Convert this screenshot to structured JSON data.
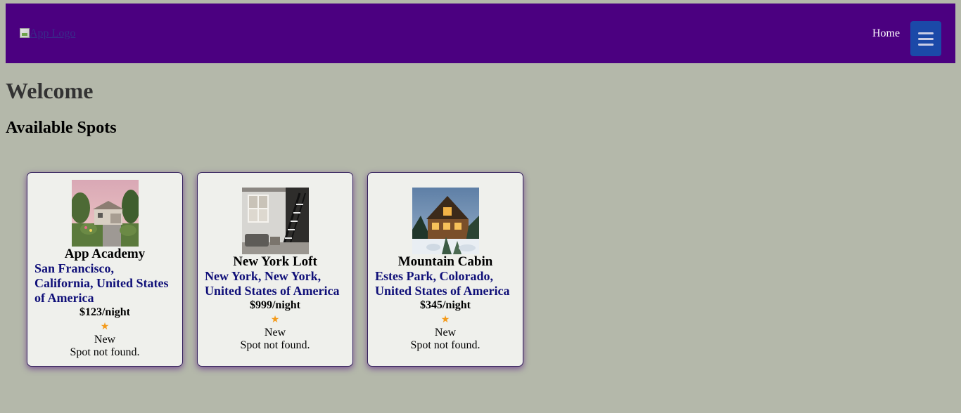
{
  "navbar": {
    "logo_alt": "App Logo",
    "home_label": "Home",
    "menu_icon": "hamburger-menu-icon",
    "background": "#4b0080",
    "menu_button_color": "#1b49a8"
  },
  "main": {
    "heading": "Welcome",
    "subheading": "Available Spots"
  },
  "spots": [
    {
      "name": "App Academy",
      "location": "San Francisco, California, United States of America",
      "price": "$123/night",
      "star": "★",
      "rating": "New",
      "status": "Spot not found."
    },
    {
      "name": "New York Loft",
      "location": "New York, New York, United States of America",
      "price": "$999/night",
      "star": "★",
      "rating": "New",
      "status": "Spot not found."
    },
    {
      "name": "Mountain Cabin",
      "location": "Estes Park, Colorado, United States of America",
      "price": "$345/night",
      "star": "★",
      "rating": "New",
      "status": "Spot not found."
    }
  ],
  "colors": {
    "page_background": "#b4b8aa",
    "card_background": "#eff0ec",
    "location_text": "#0f0f78",
    "star": "#f39a1a"
  }
}
